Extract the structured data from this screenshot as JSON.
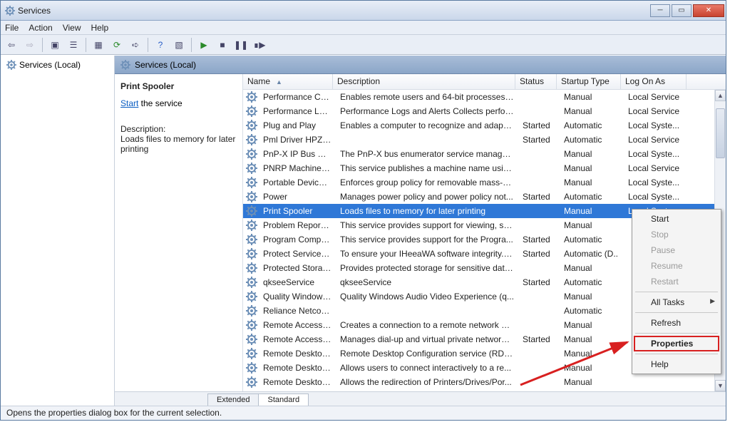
{
  "window": {
    "title": "Services"
  },
  "menubar": [
    "File",
    "Action",
    "View",
    "Help"
  ],
  "leftPane": {
    "item": "Services (Local)"
  },
  "rightHeader": "Services (Local)",
  "detail": {
    "title": "Print Spooler",
    "startLink": "Start",
    "startText": " the service",
    "descLabel": "Description:",
    "desc": "Loads files to memory for later printing"
  },
  "columns": {
    "name": "Name",
    "desc": "Description",
    "status": "Status",
    "startup": "Startup Type",
    "logon": "Log On As"
  },
  "rows": [
    {
      "name": "Performance Cou...",
      "desc": "Enables remote users and 64-bit processes to...",
      "status": "",
      "startup": "Manual",
      "logon": "Local Service"
    },
    {
      "name": "Performance Logs...",
      "desc": "Performance Logs and Alerts Collects perfor...",
      "status": "",
      "startup": "Manual",
      "logon": "Local Service"
    },
    {
      "name": "Plug and Play",
      "desc": "Enables a computer to recognize and adapt t...",
      "status": "Started",
      "startup": "Automatic",
      "logon": "Local Syste..."
    },
    {
      "name": "Pml Driver HPZ12",
      "desc": "",
      "status": "Started",
      "startup": "Automatic",
      "logon": "Local Service"
    },
    {
      "name": "PnP-X IP Bus En...",
      "desc": "The PnP-X bus enumerator service manages ...",
      "status": "",
      "startup": "Manual",
      "logon": "Local Syste..."
    },
    {
      "name": "PNRP Machine Na...",
      "desc": "This service publishes a machine name usin...",
      "status": "",
      "startup": "Manual",
      "logon": "Local Service"
    },
    {
      "name": "Portable Device E...",
      "desc": "Enforces group policy for removable mass-st...",
      "status": "",
      "startup": "Manual",
      "logon": "Local Syste..."
    },
    {
      "name": "Power",
      "desc": "Manages power policy and power policy not...",
      "status": "Started",
      "startup": "Automatic",
      "logon": "Local Syste..."
    },
    {
      "name": "Print Spooler",
      "desc": "Loads files to memory for later printing",
      "status": "",
      "startup": "Manual",
      "logon": "Local Syste...",
      "selected": true
    },
    {
      "name": "Problem Reports a...",
      "desc": "This service provides support for viewing, se...",
      "status": "",
      "startup": "Manual",
      "logon": ""
    },
    {
      "name": "Program Compati...",
      "desc": "This service provides support for the Progra...",
      "status": "Started",
      "startup": "Automatic",
      "logon": ""
    },
    {
      "name": "Protect Service(IH...",
      "desc": "To ensure your IHeeaWA software integrity. I...",
      "status": "Started",
      "startup": "Automatic (D..",
      "logon": ""
    },
    {
      "name": "Protected Storage",
      "desc": "Provides protected storage for sensitive data,...",
      "status": "",
      "startup": "Manual",
      "logon": ""
    },
    {
      "name": "qkseeService",
      "desc": "qkseeService",
      "status": "Started",
      "startup": "Automatic",
      "logon": ""
    },
    {
      "name": "Quality Windows ...",
      "desc": "Quality Windows Audio Video Experience (q...",
      "status": "",
      "startup": "Manual",
      "logon": ""
    },
    {
      "name": "Reliance Netconn...",
      "desc": "",
      "status": "",
      "startup": "Automatic",
      "logon": ""
    },
    {
      "name": "Remote Access A...",
      "desc": "Creates a connection to a remote network w...",
      "status": "",
      "startup": "Manual",
      "logon": ""
    },
    {
      "name": "Remote Access C...",
      "desc": "Manages dial-up and virtual private network ...",
      "status": "Started",
      "startup": "Manual",
      "logon": ""
    },
    {
      "name": "Remote Desktop ...",
      "desc": "Remote Desktop Configuration service (RDC...",
      "status": "",
      "startup": "Manual",
      "logon": ""
    },
    {
      "name": "Remote Desktop S...",
      "desc": "Allows users to connect interactively to a re...",
      "status": "",
      "startup": "Manual",
      "logon": ""
    },
    {
      "name": "Remote Desktop S...",
      "desc": "Allows the redirection of Printers/Drives/Por...",
      "status": "",
      "startup": "Manual",
      "logon": ""
    }
  ],
  "tabs": {
    "extended": "Extended",
    "standard": "Standard"
  },
  "statusBar": "Opens the properties dialog box for the current selection.",
  "contextMenu": {
    "start": "Start",
    "stop": "Stop",
    "pause": "Pause",
    "resume": "Resume",
    "restart": "Restart",
    "allTasks": "All Tasks",
    "refresh": "Refresh",
    "properties": "Properties",
    "help": "Help"
  }
}
